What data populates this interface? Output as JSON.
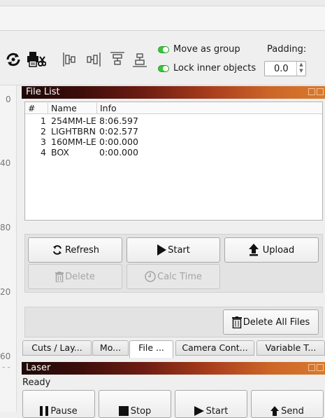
{
  "toolbar": {
    "icons": [
      "rotate-icon",
      "print-cut-icon",
      "align-left-icon",
      "align-hcenter-icon",
      "align-top-icon",
      "align-vcenter-icon"
    ],
    "move_as_group": "Move as group",
    "lock_inner_objects": "Lock inner objects",
    "padding_label": "Padding:",
    "padding_value": "0.0"
  },
  "ruler": {
    "ticks": [
      "0",
      "40",
      "80",
      "20",
      "60"
    ]
  },
  "file_list": {
    "title": "File List",
    "columns": [
      "#",
      "Name",
      "Info"
    ],
    "rows": [
      {
        "num": "1",
        "name": "254MM-LE",
        "info": "8:06.597"
      },
      {
        "num": "2",
        "name": "LIGHTBRN",
        "info": "0:02.577"
      },
      {
        "num": "3",
        "name": "160MM-LE",
        "info": "0:00.000"
      },
      {
        "num": "4",
        "name": "BOX",
        "info": "0:00.000"
      }
    ],
    "refresh": "Refresh",
    "start": "Start",
    "upload": "Upload",
    "delete": "Delete",
    "calc_time": "Calc Time",
    "delete_all": "Delete All Files"
  },
  "tabs": [
    "Cuts / Lay...",
    "Mo...",
    "File ...",
    "Camera Cont...",
    "Variable T..."
  ],
  "laser": {
    "title": "Laser",
    "status": "Ready",
    "pause": "Pause",
    "stop": "Stop",
    "start": "Start",
    "send": "Send"
  },
  "colors": {
    "toggle_on": "#3cc43c",
    "header_dark": "#1e0a08",
    "header_light": "#d87a2c"
  }
}
